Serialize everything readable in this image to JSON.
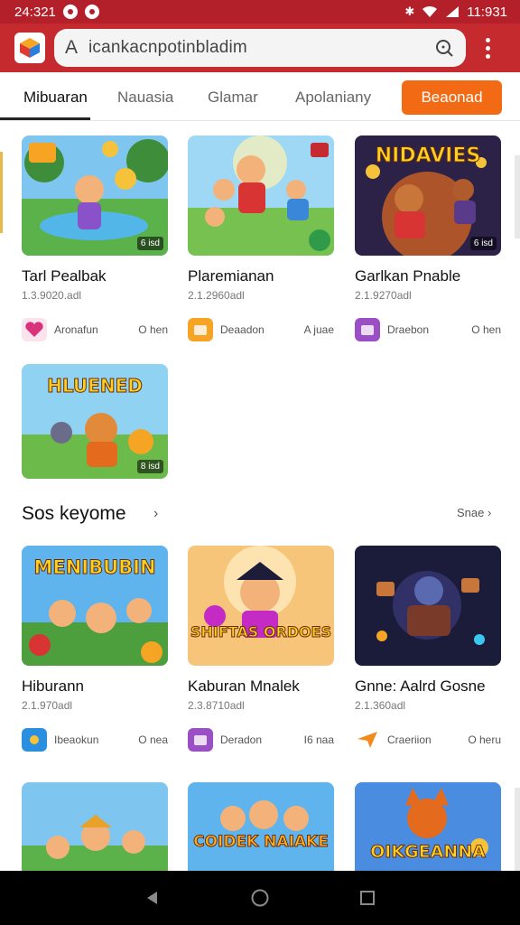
{
  "status_bar": {
    "time": "24:321",
    "right_time": "11:931"
  },
  "app_bar": {
    "search": {
      "prefix": "A",
      "text": "icankacnpotinbladim"
    }
  },
  "tabs": [
    {
      "label": "Mibuaran",
      "active": true
    },
    {
      "label": "Nauasia",
      "active": false
    },
    {
      "label": "Glamar",
      "active": false
    },
    {
      "label": "Apolaniany",
      "active": false
    }
  ],
  "tab_button": "Beaonad",
  "cards_row1": [
    {
      "title": "Tarl Pealbak",
      "sub": "1.3.9020.adl",
      "meta_label": "Aronafun",
      "meta_action": "O hen",
      "badge": "6 isd",
      "icon": "heart-gift-icon"
    },
    {
      "title": "Plaremianan",
      "sub": "2.1.2960adl",
      "meta_label": "Deaadon",
      "meta_action": "A juae",
      "badge": "",
      "icon": "orange-box-icon"
    },
    {
      "title": "Garlkan Pnable",
      "sub": "2.1.9270adl",
      "meta_label": "Draebon",
      "meta_action": "O hen",
      "badge": "6 isd",
      "icon": "purple-box-icon",
      "overlay": "NIDAVIES"
    }
  ],
  "card_single": {
    "badge": "8 isd",
    "overlay": "HLUENED"
  },
  "section": {
    "title": "Sos keyome",
    "see_all": "Snae"
  },
  "cards_row2": [
    {
      "title": "Hiburann",
      "sub": "2.1.970adl",
      "meta_label": "Ibeaokun",
      "meta_action": "O nea",
      "overlay": "MENIBUBIN",
      "icon": "blue-square-icon"
    },
    {
      "title": "Kaburan Mnalek",
      "sub": "2.3.8710adl",
      "meta_label": "Deradon",
      "meta_action": "I6 naa",
      "overlay": "SHIFTAS ORDOES",
      "icon": "purple-box-icon"
    },
    {
      "title": "Gnne: Aalrd Gosne",
      "sub": "2.1.360adl",
      "meta_label": "Craeriion",
      "meta_action": "O heru",
      "icon": "orange-arrow-icon"
    }
  ],
  "cards_row3": [
    {
      "overlay": ""
    },
    {
      "overlay": "COIDEK NAIAKE"
    },
    {
      "overlay": "OIKGEANNA"
    }
  ],
  "colors": {
    "brand_red": "#c42a2e",
    "status_red": "#b3202a",
    "accent_orange": "#f26a13"
  }
}
